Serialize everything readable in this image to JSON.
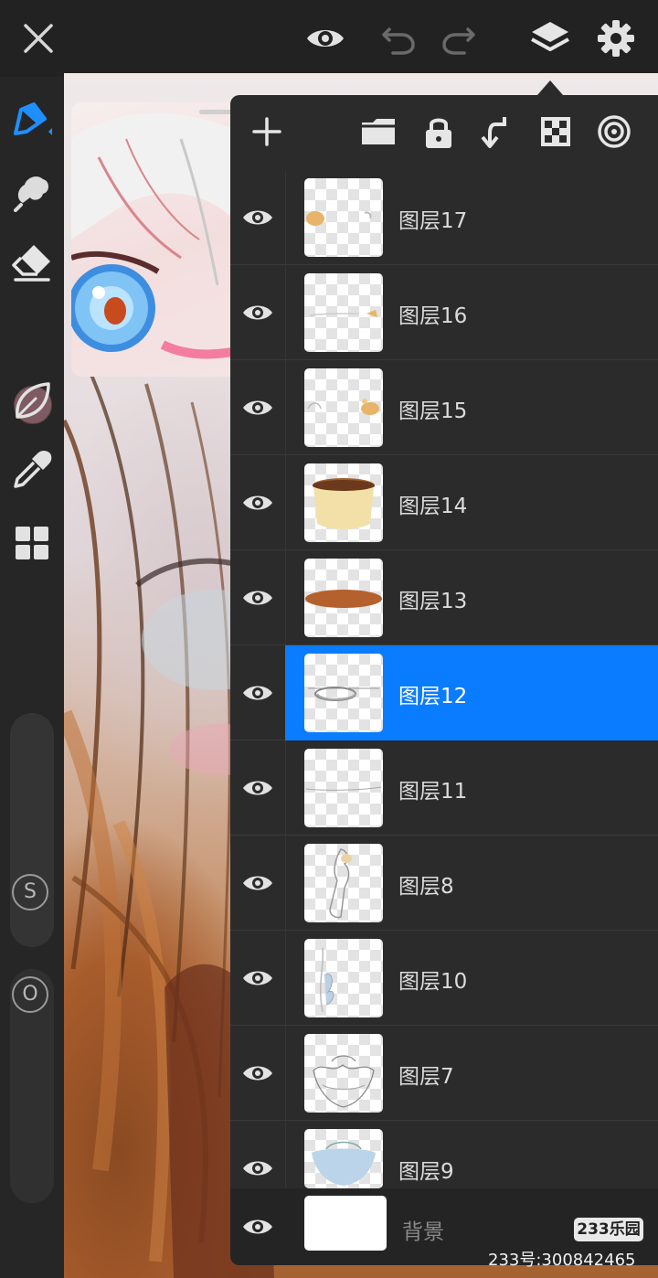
{
  "topbar": {
    "close_icon": "close-icon",
    "visibility_icon": "eye-icon",
    "undo_icon": "undo-icon",
    "redo_icon": "redo-icon",
    "layers_icon": "layers-icon",
    "settings_icon": "gear-icon"
  },
  "tools": [
    {
      "name": "brush",
      "icon": "brush-icon",
      "active": true
    },
    {
      "name": "smudge",
      "icon": "smudge-icon"
    },
    {
      "name": "eraser",
      "icon": "eraser-icon"
    },
    {
      "name": "color",
      "icon": "color-swatch",
      "color": "#7e5b63"
    },
    {
      "name": "lasso",
      "icon": "leaf-selection-icon"
    },
    {
      "name": "eyedropper",
      "icon": "eyedropper-icon"
    },
    {
      "name": "more",
      "icon": "grid-icon"
    }
  ],
  "sliders": {
    "size_label": "S",
    "opacity_label": "O"
  },
  "layers_toolbar": [
    "add-layer-icon",
    "folder-icon",
    "lock-icon",
    "merge-down-icon",
    "transparency-icon",
    "mask-icon"
  ],
  "layers": [
    {
      "name": "图层17",
      "visible": true,
      "selected": false
    },
    {
      "name": "图层16",
      "visible": true,
      "selected": false
    },
    {
      "name": "图层15",
      "visible": true,
      "selected": false
    },
    {
      "name": "图层14",
      "visible": true,
      "selected": false
    },
    {
      "name": "图层13",
      "visible": true,
      "selected": false
    },
    {
      "name": "图层12",
      "visible": true,
      "selected": true
    },
    {
      "name": "图层11",
      "visible": true,
      "selected": false
    },
    {
      "name": "图层8",
      "visible": true,
      "selected": false
    },
    {
      "name": "图层10",
      "visible": true,
      "selected": false
    },
    {
      "name": "图层7",
      "visible": true,
      "selected": false
    },
    {
      "name": "图层9",
      "visible": true,
      "selected": false
    }
  ],
  "background_layer": {
    "name": "背景",
    "visible": true
  },
  "watermark": {
    "logo": "233乐园",
    "id_text": "233号:300842465"
  },
  "colors": {
    "accent": "#0a7cff",
    "panel": "#2b2b2b",
    "brush_active": "#1e8fff"
  }
}
